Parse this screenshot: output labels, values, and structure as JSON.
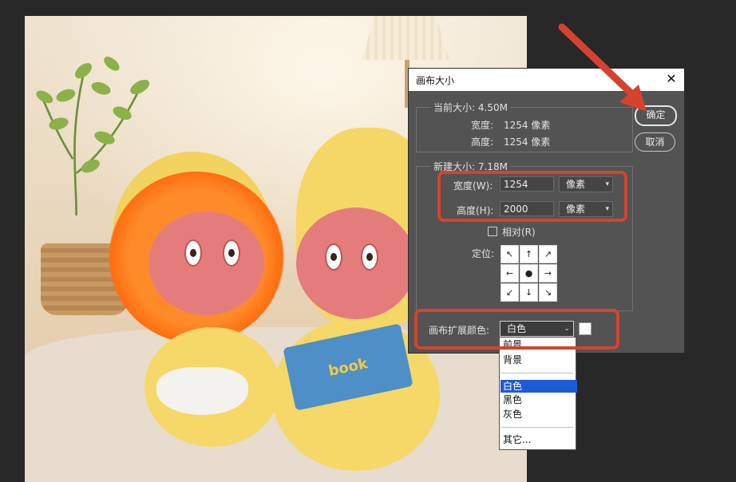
{
  "dialog": {
    "title": "画布大小",
    "current_size_label": "当前大小: 4.50M",
    "current_width_label": "宽度:",
    "current_width_value": "1254 像素",
    "current_height_label": "高度:",
    "current_height_value": "1254 像素",
    "new_size_label": "新建大小: 7.18M",
    "width_label": "宽度(W):",
    "width_value": "1254",
    "width_unit": "像素",
    "height_label": "高度(H):",
    "height_value": "2000",
    "height_unit": "像素",
    "relative_label": "相对(R)",
    "anchor_label": "定位:",
    "extension_color_label": "画布扩展颜色:",
    "extension_color_value": "白色",
    "ok_label": "确定",
    "cancel_label": "取消"
  },
  "dropdown": {
    "items": [
      "前景",
      "背景",
      "白色",
      "黑色",
      "灰色",
      "其它..."
    ],
    "selected": "白色"
  },
  "photo": {
    "book_text": "book"
  },
  "colors": {
    "dialog_bg": "#535353",
    "highlight": "#d5432d",
    "selected_item": "#1e5bd6"
  }
}
